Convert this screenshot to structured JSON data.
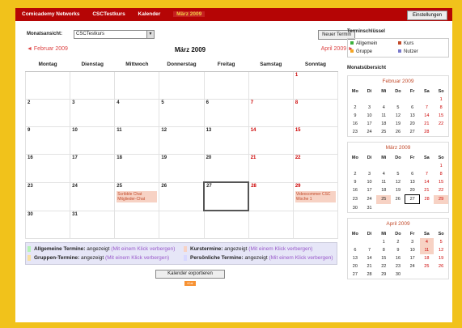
{
  "topbar": {
    "items": [
      "Comicademy Networks",
      "CSCTestkurs",
      "Kalender",
      "März 2009"
    ],
    "settings_label": "Einstellungen"
  },
  "main": {
    "month_view_label": "Monatsansicht:",
    "course_select": "CSCTestkurs",
    "new_event_label": "Neuer Termin",
    "prev_month": "◄ Februar 2009",
    "current_month": "März 2009",
    "next_month": "April 2009 ►",
    "weekdays": [
      "Montag",
      "Dienstag",
      "Mittwoch",
      "Donnerstag",
      "Freitag",
      "Samstag",
      "Sonntag"
    ],
    "weeks": [
      [
        null,
        null,
        null,
        null,
        null,
        null,
        "1"
      ],
      [
        "2",
        "3",
        "4",
        "5",
        "6",
        "7",
        "8"
      ],
      [
        "9",
        "10",
        "11",
        "12",
        "13",
        "14",
        "15"
      ],
      [
        "16",
        "17",
        "18",
        "19",
        "20",
        "21",
        "22"
      ],
      [
        "23",
        "24",
        "25",
        "26",
        "27",
        "28",
        "29"
      ],
      [
        "30",
        "31",
        null,
        null,
        null,
        null,
        null
      ]
    ],
    "events": {
      "25": "Scribble Chat Mitglieder-Chat",
      "29": "Videocommer CSC Woche 1"
    },
    "today": "27",
    "legend": [
      {
        "title": "Allgemeine Termine:",
        "state": "angezeigt",
        "link": "(Mit einem Klick verbergen)"
      },
      {
        "title": "Kurstermine:",
        "state": "angezeigt",
        "link": "(Mit einem Klick verbergen)"
      },
      {
        "title": "Gruppen-Termine:",
        "state": "angezeigt",
        "link": "(Mit einem Klick verbergen)"
      },
      {
        "title": "Persönliche Termine:",
        "state": "angezeigt",
        "link": "(Mit einem Klick verbergen)"
      }
    ],
    "export_label": "Kalender exportieren",
    "ical_label": "iCal"
  },
  "side": {
    "key_title": "Terminschlüssel",
    "key_items": [
      {
        "label": "Allgemein",
        "color": "#3bb03b"
      },
      {
        "label": "Kurs",
        "color": "#c24a2a"
      },
      {
        "label": "Gruppe",
        "color": "#f5a623"
      },
      {
        "label": "Nutzer",
        "color": "#7a7acc"
      }
    ],
    "overview_title": "Monatsübersicht",
    "mini_headers": [
      "Mo",
      "Di",
      "Mi",
      "Do",
      "Fr",
      "Sa",
      "So"
    ],
    "mini_months": [
      {
        "title": "Februar 2009",
        "rows": [
          [
            "",
            "",
            "",
            "",
            "",
            "",
            "1"
          ],
          [
            "2",
            "3",
            "4",
            "5",
            "6",
            "7",
            "8"
          ],
          [
            "9",
            "10",
            "11",
            "12",
            "13",
            "14",
            "15"
          ],
          [
            "16",
            "17",
            "18",
            "19",
            "20",
            "21",
            "22"
          ],
          [
            "23",
            "24",
            "25",
            "26",
            "27",
            "28",
            ""
          ]
        ]
      },
      {
        "title": "März 2009",
        "rows": [
          [
            "",
            "",
            "",
            "",
            "",
            "",
            "1"
          ],
          [
            "2",
            "3",
            "4",
            "5",
            "6",
            "7",
            "8"
          ],
          [
            "9",
            "10",
            "11",
            "12",
            "13",
            "14",
            "15"
          ],
          [
            "16",
            "17",
            "18",
            "19",
            "20",
            "21",
            "22"
          ],
          [
            "23",
            "24",
            "25",
            "26",
            "27",
            "28",
            "29"
          ],
          [
            "30",
            "31",
            "",
            "",
            "",
            "",
            ""
          ]
        ]
      },
      {
        "title": "April 2009",
        "rows": [
          [
            "",
            "",
            "1",
            "2",
            "3",
            "4",
            "5"
          ],
          [
            "6",
            "7",
            "8",
            "9",
            "10",
            "11",
            "12"
          ],
          [
            "13",
            "14",
            "15",
            "16",
            "17",
            "18",
            "19"
          ],
          [
            "20",
            "21",
            "22",
            "23",
            "24",
            "25",
            "26"
          ],
          [
            "27",
            "28",
            "29",
            "30",
            "",
            "",
            ""
          ]
        ]
      }
    ]
  }
}
